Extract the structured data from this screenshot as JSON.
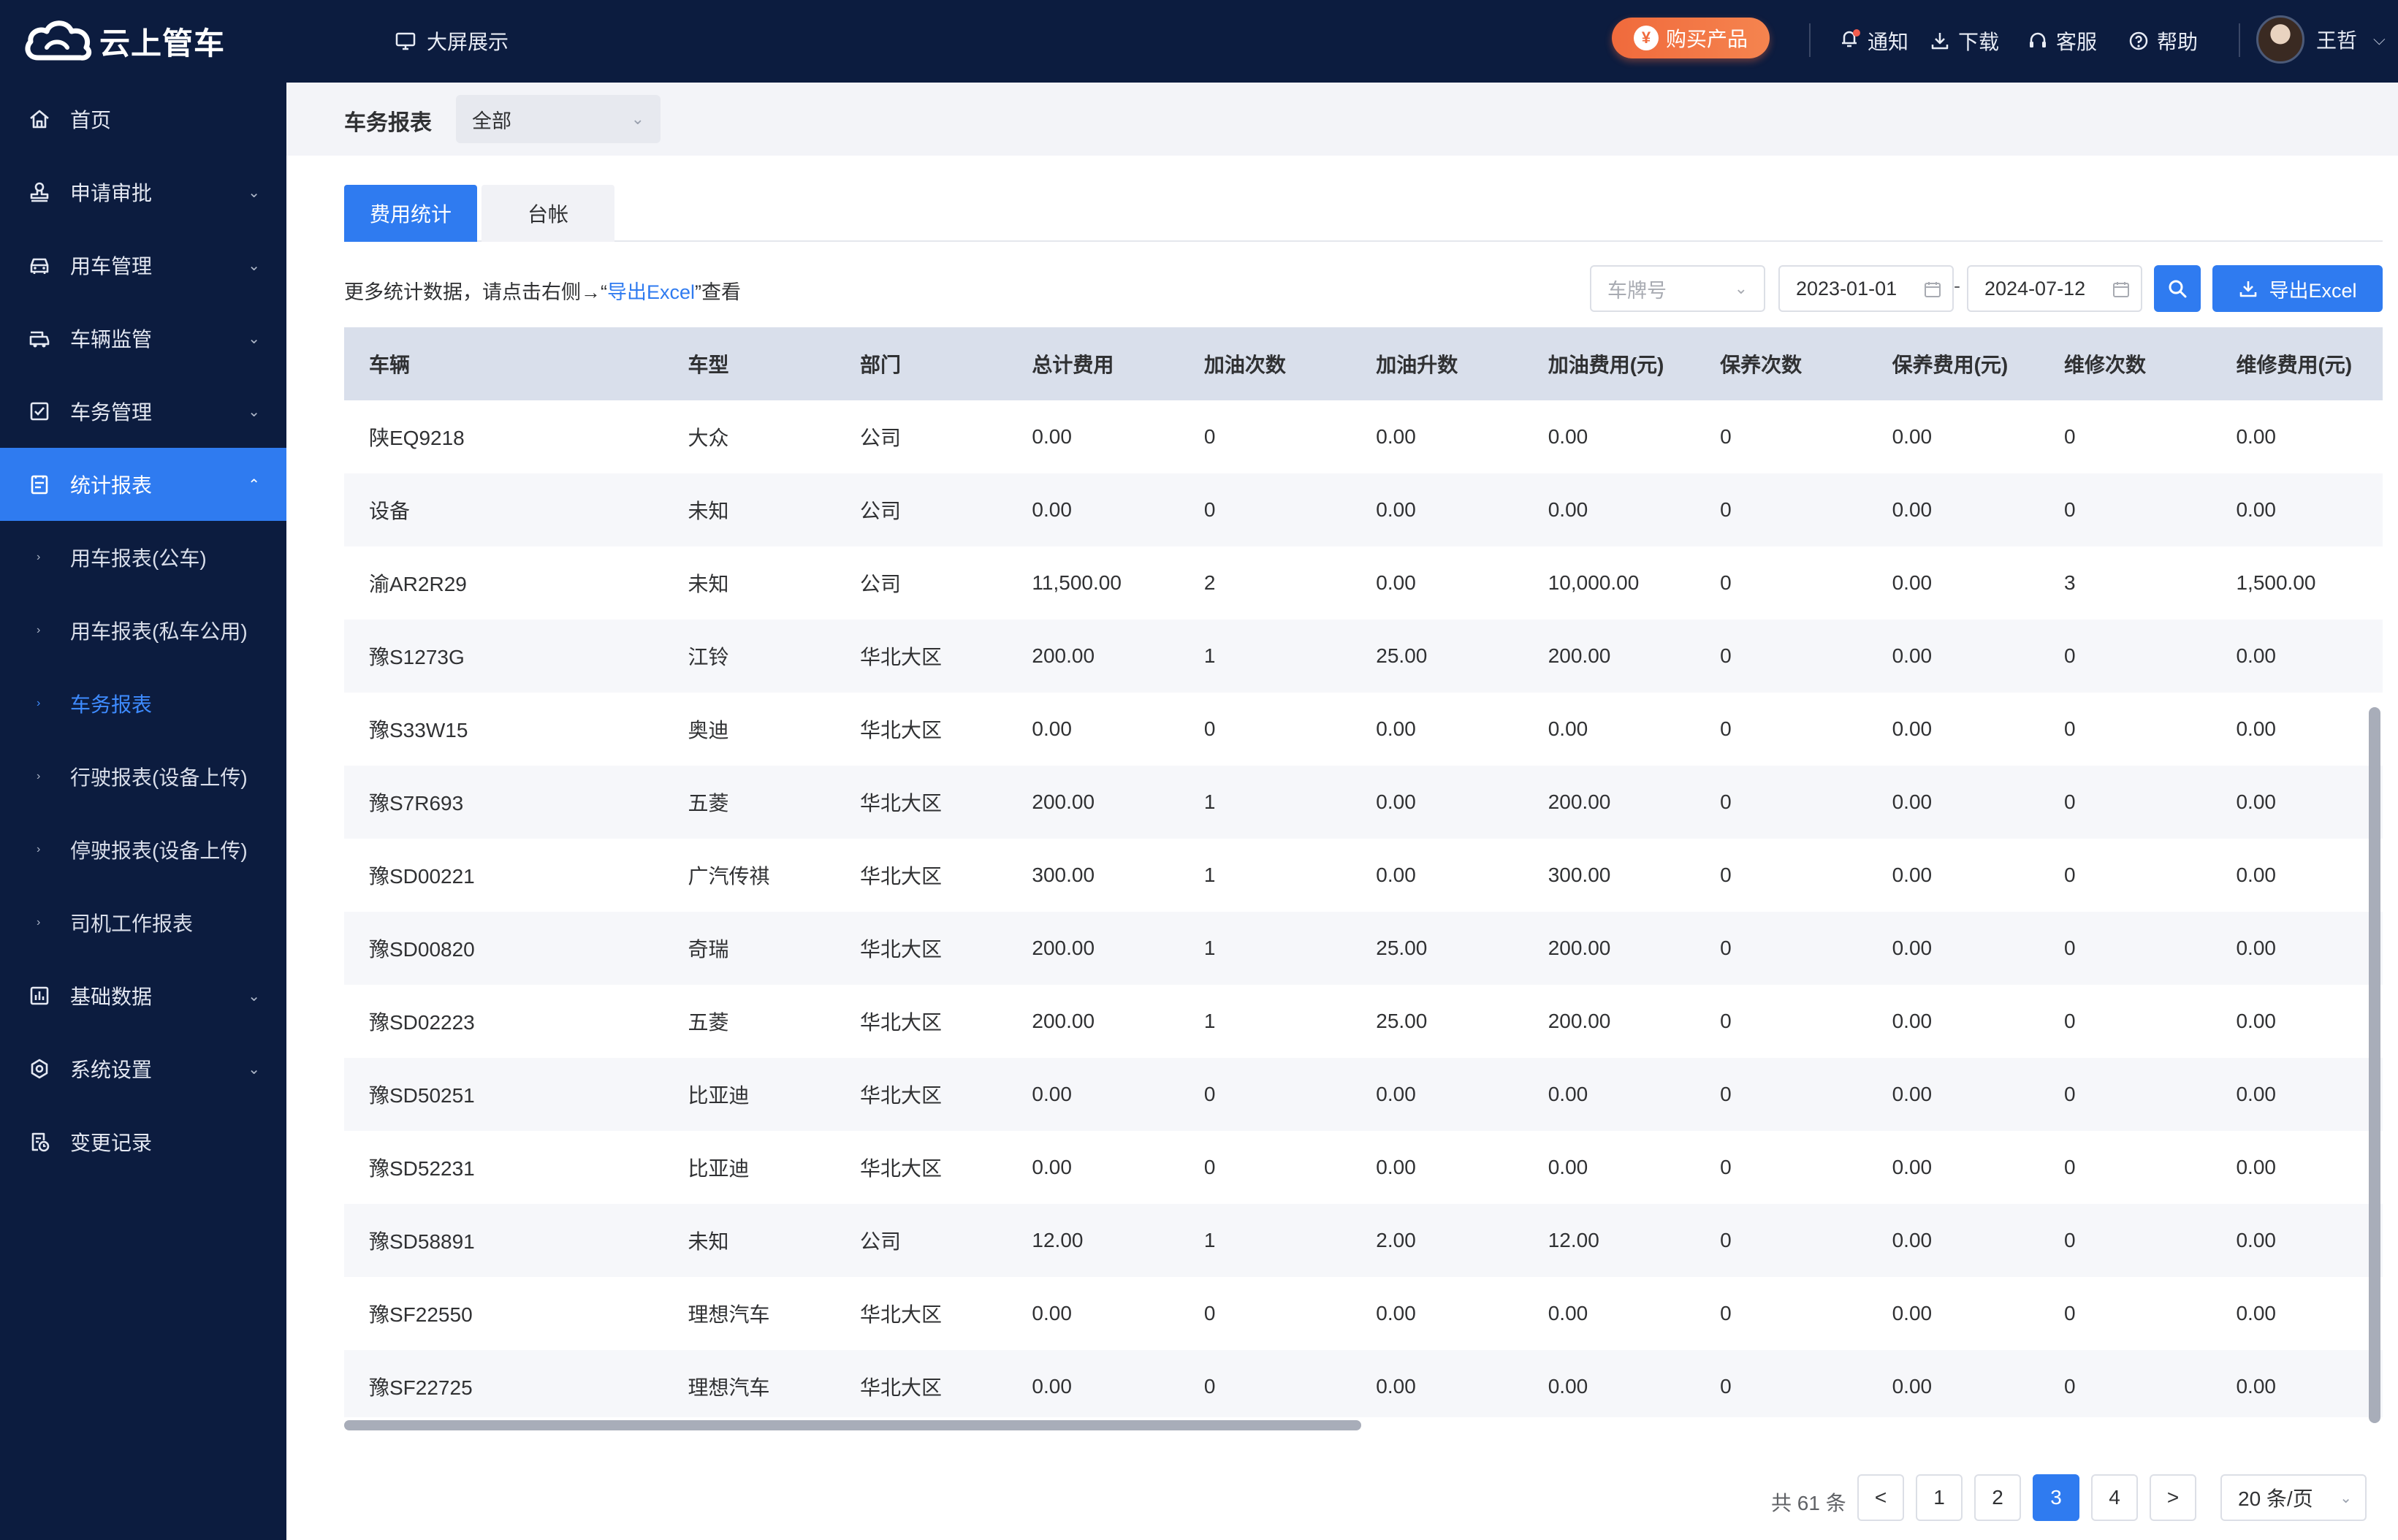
{
  "app": {
    "logo_text": "云上管车",
    "bigscreen_label": "大屏展示",
    "buy_label": "购买产品",
    "buy_coin": "¥",
    "nav": {
      "notify": "通知",
      "download": "下载",
      "service": "客服",
      "help": "帮助"
    },
    "user_name": "王哲"
  },
  "sidebar": {
    "items": [
      {
        "label": "首页",
        "icon": "home-icon"
      },
      {
        "label": "申请审批",
        "icon": "stamp-icon"
      },
      {
        "label": "用车管理",
        "icon": "car-icon"
      },
      {
        "label": "车辆监管",
        "icon": "truck-icon"
      },
      {
        "label": "车务管理",
        "icon": "checkbox-icon"
      },
      {
        "label": "统计报表",
        "icon": "report-icon"
      },
      {
        "label": "基础数据",
        "icon": "bar-chart-icon"
      },
      {
        "label": "系统设置",
        "icon": "settings-icon"
      },
      {
        "label": "变更记录",
        "icon": "record-icon"
      }
    ],
    "subitems": [
      {
        "label": "用车报表(公车)"
      },
      {
        "label": "用车报表(私车公用)"
      },
      {
        "label": "车务报表"
      },
      {
        "label": "行驶报表(设备上传)"
      },
      {
        "label": "停驶报表(设备上传)"
      },
      {
        "label": "司机工作报表"
      }
    ]
  },
  "header": {
    "title": "车务报表",
    "scope_value": "全部"
  },
  "tabs": [
    {
      "label": "费用统计"
    },
    {
      "label": "台帐"
    }
  ],
  "hint": {
    "prefix": "更多统计数据，请点击右侧→“",
    "link": "导出Excel",
    "suffix": "”查看"
  },
  "filters": {
    "plate_placeholder": "车牌号",
    "date_start": "2023-01-01",
    "date_end": "2024-07-12",
    "date_sep": "-",
    "export_label": "导出Excel"
  },
  "table": {
    "columns": [
      "车辆",
      "车型",
      "部门",
      "总计费用",
      "加油次数",
      "加油升数",
      "加油费用(元)",
      "保养次数",
      "保养费用(元)",
      "维修次数",
      "维修费用(元)"
    ],
    "rows": [
      [
        "陕EQ9218",
        "大众",
        "公司",
        "0.00",
        "0",
        "0.00",
        "0.00",
        "0",
        "0.00",
        "0",
        "0.00"
      ],
      [
        "设备",
        "未知",
        "公司",
        "0.00",
        "0",
        "0.00",
        "0.00",
        "0",
        "0.00",
        "0",
        "0.00"
      ],
      [
        "渝AR2R29",
        "未知",
        "公司",
        "11,500.00",
        "2",
        "0.00",
        "10,000.00",
        "0",
        "0.00",
        "3",
        "1,500.00"
      ],
      [
        "豫S1273G",
        "江铃",
        "华北大区",
        "200.00",
        "1",
        "25.00",
        "200.00",
        "0",
        "0.00",
        "0",
        "0.00"
      ],
      [
        "豫S33W15",
        "奥迪",
        "华北大区",
        "0.00",
        "0",
        "0.00",
        "0.00",
        "0",
        "0.00",
        "0",
        "0.00"
      ],
      [
        "豫S7R693",
        "五菱",
        "华北大区",
        "200.00",
        "1",
        "0.00",
        "200.00",
        "0",
        "0.00",
        "0",
        "0.00"
      ],
      [
        "豫SD00221",
        "广汽传祺",
        "华北大区",
        "300.00",
        "1",
        "0.00",
        "300.00",
        "0",
        "0.00",
        "0",
        "0.00"
      ],
      [
        "豫SD00820",
        "奇瑞",
        "华北大区",
        "200.00",
        "1",
        "25.00",
        "200.00",
        "0",
        "0.00",
        "0",
        "0.00"
      ],
      [
        "豫SD02223",
        "五菱",
        "华北大区",
        "200.00",
        "1",
        "25.00",
        "200.00",
        "0",
        "0.00",
        "0",
        "0.00"
      ],
      [
        "豫SD50251",
        "比亚迪",
        "华北大区",
        "0.00",
        "0",
        "0.00",
        "0.00",
        "0",
        "0.00",
        "0",
        "0.00"
      ],
      [
        "豫SD52231",
        "比亚迪",
        "华北大区",
        "0.00",
        "0",
        "0.00",
        "0.00",
        "0",
        "0.00",
        "0",
        "0.00"
      ],
      [
        "豫SD58891",
        "未知",
        "公司",
        "12.00",
        "1",
        "2.00",
        "12.00",
        "0",
        "0.00",
        "0",
        "0.00"
      ],
      [
        "豫SF22550",
        "理想汽车",
        "华北大区",
        "0.00",
        "0",
        "0.00",
        "0.00",
        "0",
        "0.00",
        "0",
        "0.00"
      ],
      [
        "豫SF22725",
        "理想汽车",
        "华北大区",
        "0.00",
        "0",
        "0.00",
        "0.00",
        "0",
        "0.00",
        "0",
        "0.00"
      ]
    ]
  },
  "pagination": {
    "total": "共 61 条",
    "prev": "<",
    "next": ">",
    "pages": [
      "1",
      "2",
      "3",
      "4"
    ],
    "current": "3",
    "page_size": "20 条/页"
  },
  "colors": {
    "nav_bg": "#0c1c3f",
    "primary": "#2f7bf0",
    "buy_orange": "#f06a3c"
  }
}
